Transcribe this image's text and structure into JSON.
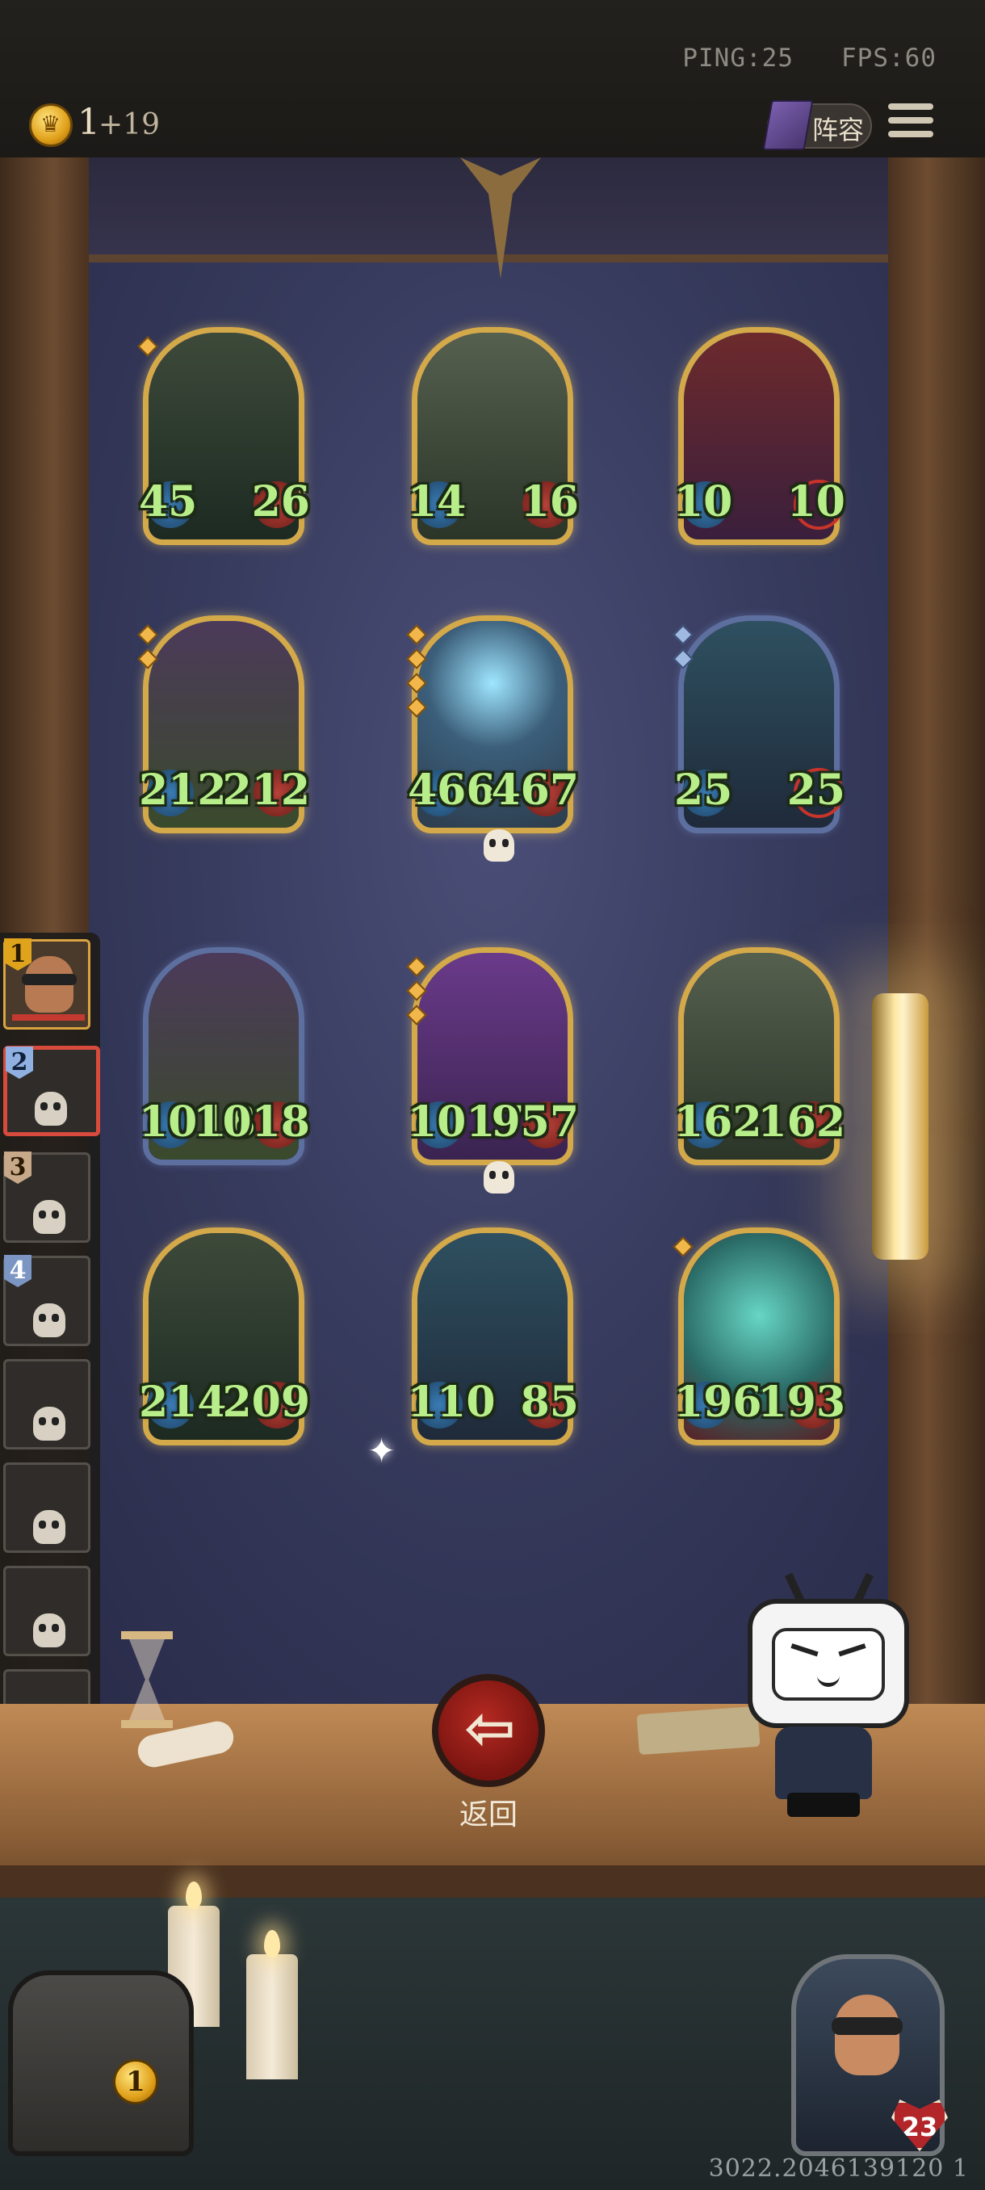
{
  "status": {
    "ping_label": "PING:25",
    "fps_label": "FPS:60"
  },
  "resources": {
    "gold": "1",
    "gold_income": "+19",
    "coin_icon": "crown-coin-icon"
  },
  "toolbar": {
    "lineup_label": "阵容",
    "menu_icon": "hamburger-menu-icon"
  },
  "board": {
    "cards": [
      {
        "atk": "45",
        "hp": "26"
      },
      {
        "atk": "14",
        "hp": "16"
      },
      {
        "atk": "10",
        "hp": "10"
      },
      {
        "atk": "212",
        "hp": "212"
      },
      {
        "atk": "466",
        "hp": "467"
      },
      {
        "atk": "25",
        "hp": "25"
      },
      {
        "atk": "1018",
        "hp": "1018"
      },
      {
        "atk": "1017",
        "hp": "957"
      },
      {
        "atk": "162",
        "hp": "162"
      },
      {
        "atk": "214",
        "hp": "209"
      },
      {
        "atk": "110",
        "hp": "85"
      },
      {
        "atk": "196",
        "hp": "193"
      }
    ]
  },
  "opponents": {
    "slots": [
      {
        "rank": "1"
      },
      {
        "rank": "2"
      },
      {
        "rank": "3"
      },
      {
        "rank": "4"
      },
      {
        "rank": ""
      },
      {
        "rank": ""
      },
      {
        "rank": ""
      },
      {
        "rank": ""
      }
    ]
  },
  "back_button": {
    "label": "返回"
  },
  "treasure": {
    "count": "1"
  },
  "hero": {
    "health": "23"
  },
  "footer": {
    "build": "3022.2046139120 1"
  }
}
